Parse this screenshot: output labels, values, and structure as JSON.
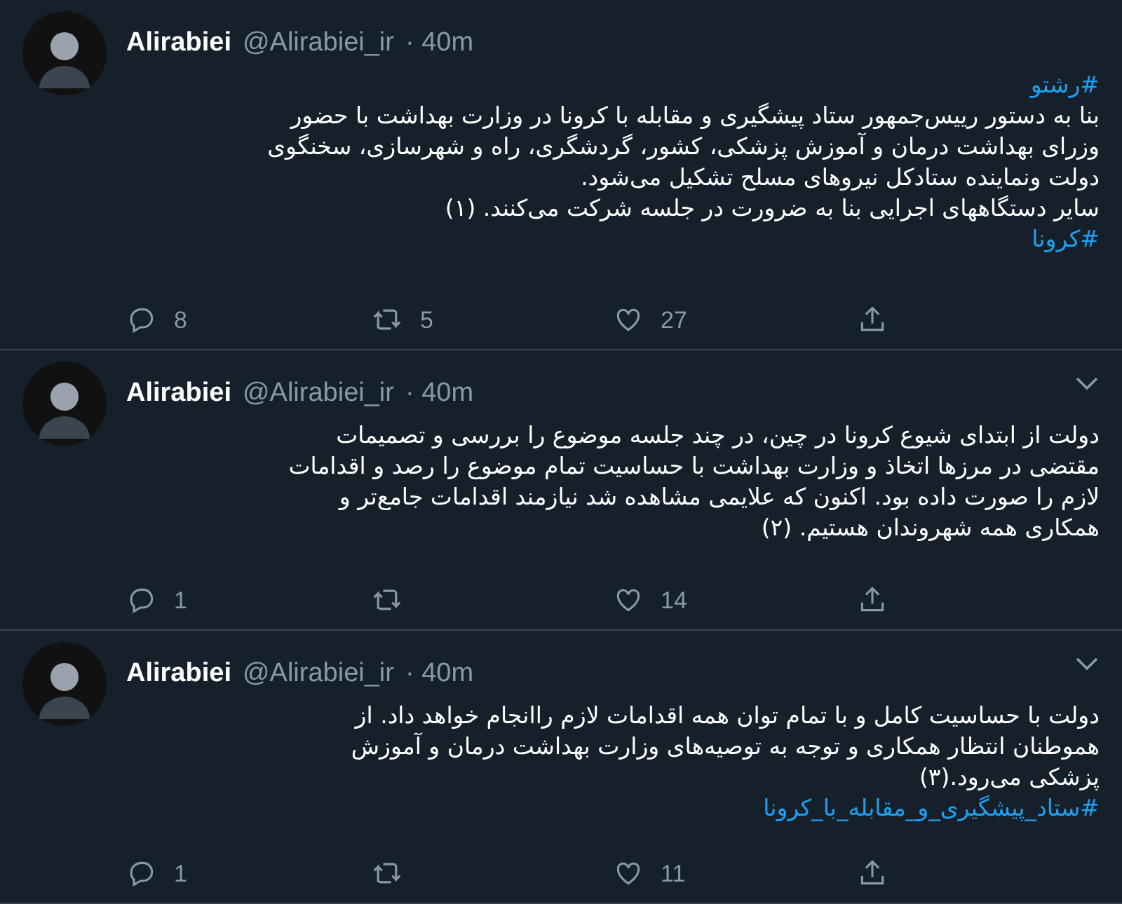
{
  "tweets": [
    {
      "name": "Alirabiei",
      "handle": "@Alirabiei_ir",
      "time": "· 40m",
      "menu": false,
      "hashtag_top": "#رشتو",
      "text": "بنا به دستور رییس‌جمهور ستاد پیشگیری و مقابله با کرونا در وزارت بهداشت با حضور\nوزرای بهداشت درمان و آموزش پزشکی، کشور، گردشگری، راه و شهرسازی، سخنگوی\nدولت ونماینده ستادکل نیروهای مسلح تشکیل می‌شود.\nسایر دستگاههای اجرایی بنا به ضرورت در جلسه شرکت می‌کنند. (۱)",
      "hashtag_bottom": "#کرونا",
      "replies": "8",
      "retweets": "5",
      "likes": "27"
    },
    {
      "name": "Alirabiei",
      "handle": "@Alirabiei_ir",
      "time": "· 40m",
      "menu": true,
      "text": "دولت از ابتدای شیوع کرونا در چین، در چند جلسه موضوع را بررسی و تصمیمات\nمقتضی در مرزها اتخاذ و وزارت بهداشت با حساسیت تمام موضوع را رصد و اقدامات\nلازم را صورت داده بود. اکنون که علایمی مشاهده شد نیازمند اقدامات جامع‌تر و\nهمکاری همه شهروندان هستیم. (۲)",
      "replies": "1",
      "likes": "14"
    },
    {
      "name": "Alirabiei",
      "handle": "@Alirabiei_ir",
      "time": "· 40m",
      "menu": true,
      "text": "دولت با حساسیت کامل و با تمام توان همه اقدامات لازم راانجام خواهد داد. از\nهموطنان انتظار همکاری و توجه به توصیه‌های وزارت بهداشت درمان و آموزش\nپزشکی می‌رود.(۳)",
      "hashtag_bottom": "#ستاد_پیشگیری_و_مقابله_با_کرونا",
      "replies": "1",
      "likes": "11"
    }
  ]
}
